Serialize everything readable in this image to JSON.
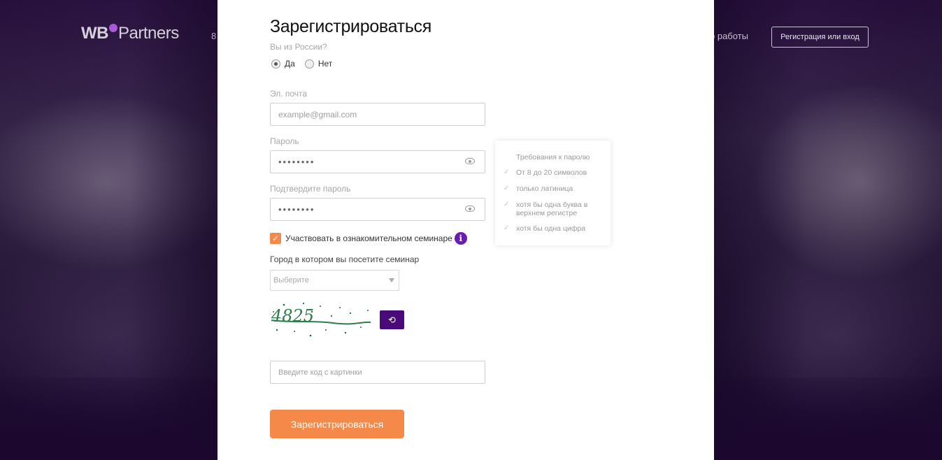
{
  "header": {
    "logo_wb": "WB",
    "logo_partners": "Partners",
    "nav_left_peek": "8",
    "nav_right_peek": "о работы",
    "auth_button": "Регистрация или вход"
  },
  "form": {
    "title": "Зарегистрироваться",
    "russia_question": "Вы из России?",
    "radio_options": [
      {
        "label": "Да",
        "checked": true
      },
      {
        "label": "Нет",
        "checked": false
      }
    ],
    "email_label": "Эл. почта",
    "email_placeholder": "example@gmail.com",
    "password_label": "Пароль",
    "password_value": "••••••••",
    "confirm_label": "Подтвердите пароль",
    "confirm_value": "••••••••",
    "seminar_checkbox_label": "Участвовать в ознакомительном семинаре",
    "seminar_checked": true,
    "info_icon_glyph": "i",
    "city_label": "Город в котором вы посетите семинар",
    "city_select_value": "Выберите",
    "captcha_text": "4825",
    "code_placeholder": "Введите код с картинки",
    "submit_label": "Зарегистрироваться"
  },
  "password_requirements": {
    "title": "Требования к паролю",
    "items": [
      "От 8 до 20 символов",
      "только латиница",
      "хотя бы одна буква в верхнем регистре",
      "хотя бы одна цифра"
    ]
  },
  "colors": {
    "accent_orange": "#f5894a",
    "brand_purple": "#6b1cb0",
    "refresh_button": "#4a0a7a"
  },
  "icons": [
    "eye-icon",
    "check-icon",
    "info-icon",
    "refresh-icon",
    "chevron-down-icon"
  ]
}
